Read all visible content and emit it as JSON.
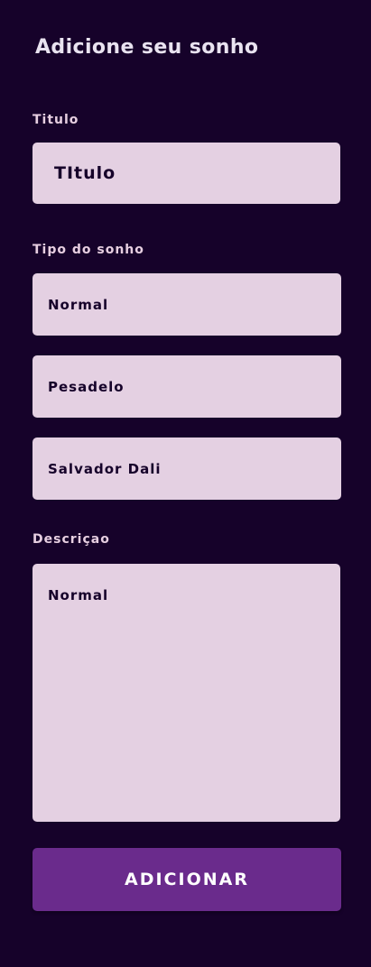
{
  "header": {
    "title": "Adicione seu sonho"
  },
  "form": {
    "title_label": "Titulo",
    "title_value": "TItulo",
    "type_label": "Tipo do sonho",
    "type_options": [
      "Normal",
      "Pesadelo",
      "Salvador Dali"
    ],
    "description_label": "Descriçao",
    "description_value": "Normal",
    "submit_label": "ADICIONAR"
  },
  "colors": {
    "background": "#16022a",
    "field_background": "#e4d0e2",
    "label_text": "#e7cfe1",
    "button_background": "#6a2b8c",
    "button_text": "#ffffff"
  }
}
